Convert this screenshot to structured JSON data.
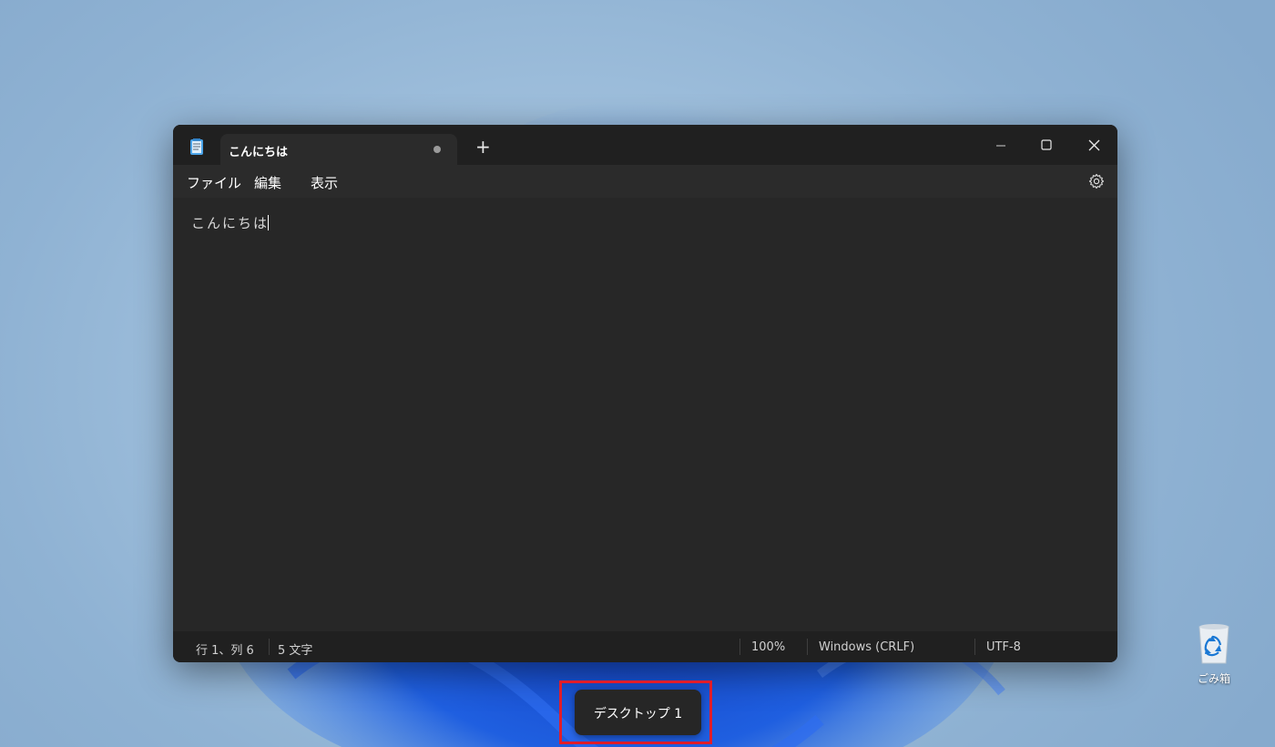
{
  "notepad": {
    "tab_title": "こんにちは",
    "new_tab_symbol": "+",
    "menu": {
      "file": "ファイル",
      "edit": "編集",
      "view": "表示"
    },
    "editor_text": "こんにちは",
    "status": {
      "position": "行 1、列 6",
      "char_count": "5 文字",
      "zoom": "100%",
      "line_ending": "Windows (CRLF)",
      "encoding": "UTF-8"
    }
  },
  "desktop": {
    "switcher_label": "デスクトップ 1",
    "recycle_bin_label": "ごみ箱"
  },
  "colors": {
    "highlight": "#e11d2a",
    "window_bg": "#272727"
  }
}
